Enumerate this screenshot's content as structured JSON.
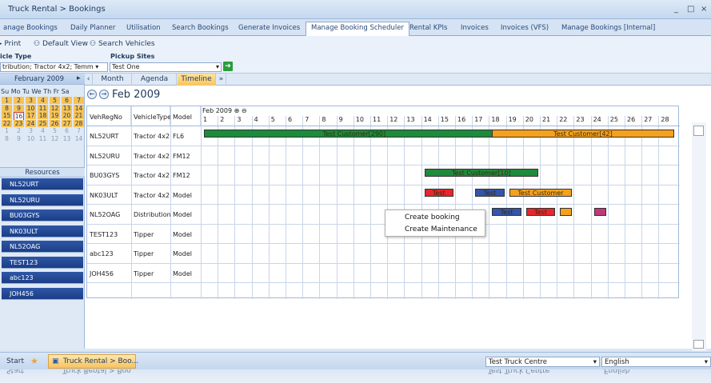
{
  "window": {
    "title": "Truck Rental > Bookings",
    "controls": [
      "_",
      "□",
      "×"
    ]
  },
  "tabs": [
    "anage Bookings",
    "Daily Planner",
    "Utilisation",
    "Search Bookings",
    "Generate Invoices",
    "Manage Booking Scheduler",
    "Rental KPIs",
    "Invoices",
    "Invoices (VFS)",
    "Manage Bookings [Internal]"
  ],
  "active_tab": "Manage Booking Scheduler",
  "toolbar": {
    "print": "Print",
    "default_view": "Default View",
    "search_vehicles": "Search Vehicles"
  },
  "filters": {
    "vehicle_type_label": "icle Type",
    "vehicle_type_value": "tribution; Tractor 4x2; Temm",
    "pickup_label": "Pickup Sites",
    "pickup_value": "Test One"
  },
  "calendar": {
    "month": "February 2009",
    "days": "Su Mo Tu We Th Fr Sa",
    "rows": [
      "1  2  3  4  5  6  7",
      "8  9  10 11 12 13 14",
      "15 16 17 18 19 20 21",
      "22 23 24 25 26 27 28",
      "1  2  3  4  5  6  7",
      "8  9  10 11 12 13 14"
    ],
    "today": "16"
  },
  "resources_title": "Resources",
  "resources": [
    "NL52URT",
    "NL52URU",
    "BU03GYS",
    "NK03ULT",
    "NL52OAG",
    "TEST123",
    "abc123",
    "JOH456"
  ],
  "view_tabs": [
    "Month",
    "Agenda",
    "Timeline"
  ],
  "active_view": "Timeline",
  "scheduler": {
    "date_heading": "Feb 2009",
    "col_vehreg": "VehRegNo",
    "col_type": "VehicleType",
    "col_model": "Model",
    "month_label": "Feb 2009",
    "days": [
      "1",
      "2",
      "3",
      "4",
      "5",
      "6",
      "7",
      "8",
      "9",
      "10",
      "11",
      "12",
      "13",
      "14",
      "15",
      "16",
      "17",
      "18",
      "19",
      "20",
      "21",
      "22",
      "23",
      "24",
      "25",
      "26",
      "27",
      "28"
    ]
  },
  "vehicles": [
    {
      "reg": "NL52URT",
      "type": "Tractor 4x2",
      "model": "FL6"
    },
    {
      "reg": "NL52URU",
      "type": "Tractor 4x2",
      "model": "FM12"
    },
    {
      "reg": "BU03GYS",
      "type": "Tractor 4x2",
      "model": "FM12"
    },
    {
      "reg": "NK03ULT",
      "type": "Tractor 4x2",
      "model": "Model"
    },
    {
      "reg": "NL52OAG",
      "type": "Distribution",
      "model": "Model"
    },
    {
      "reg": "TEST123",
      "type": "Tipper",
      "model": "Model"
    },
    {
      "reg": "abc123",
      "type": "Tipper",
      "model": "Model"
    },
    {
      "reg": "JOH456",
      "type": "Tipper",
      "model": "Model"
    }
  ],
  "bookings": [
    {
      "row": 0,
      "start": 1,
      "end": 18,
      "label": "Test Customer[290]",
      "color": "#1e8a3c"
    },
    {
      "row": 0,
      "start": 18,
      "end": 28,
      "label": "Test Customer[42]",
      "color": "#f5a11c"
    },
    {
      "row": 2,
      "start": 14,
      "end": 20,
      "label": "Test Customer[10]",
      "color": "#1e8a3c"
    },
    {
      "row": 3,
      "start": 14,
      "end": 15,
      "label": "Test",
      "color": "#e8262b"
    },
    {
      "row": 3,
      "start": 17,
      "end": 18,
      "label": "Test",
      "color": "#3355aa"
    },
    {
      "row": 3,
      "start": 19,
      "end": 22,
      "label": "Test Customer",
      "color": "#f5a11c"
    },
    {
      "row": 4,
      "start": 18,
      "end": 19,
      "label": "Test",
      "color": "#3355aa"
    },
    {
      "row": 4,
      "start": 20,
      "end": 21,
      "label": "Test",
      "color": "#e8262b"
    },
    {
      "row": 4,
      "start": 22,
      "end": 22,
      "label": "",
      "color": "#f5a11c"
    },
    {
      "row": 4,
      "start": 24,
      "end": 24,
      "label": "",
      "color": "#c0387a"
    }
  ],
  "context_menu": [
    "Create booking",
    "Create Maintenance"
  ],
  "taskbar": {
    "start": "Start",
    "task": "Truck Rental > Boo...",
    "centre": "Test Truck Centre",
    "language": "English"
  }
}
